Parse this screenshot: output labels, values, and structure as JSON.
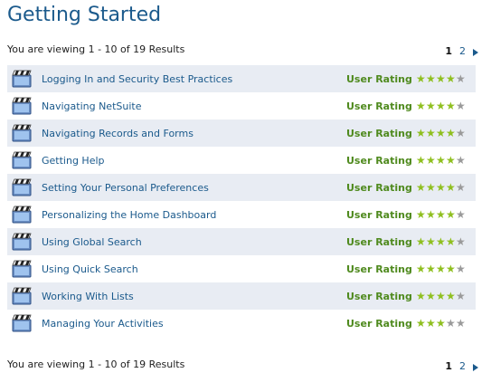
{
  "page": {
    "title": "Getting Started"
  },
  "results_summary": "You are viewing 1 - 10 of 19 Results",
  "pagination": {
    "current": "1",
    "next_page": "2"
  },
  "rating_label": "User Rating",
  "colors": {
    "title": "#1b5a8c",
    "link": "#1b5a8c",
    "rating_label": "#4f8a1e",
    "star_on": "#8fbf1f",
    "star_off": "#9a9a9a",
    "row_alt": "#e8ecf3"
  },
  "items": [
    {
      "title": "Logging In and Security Best Practices",
      "rating": 4,
      "icon": "video-clapper-icon"
    },
    {
      "title": "Navigating NetSuite",
      "rating": 4,
      "icon": "video-clapper-icon"
    },
    {
      "title": "Navigating Records and Forms",
      "rating": 4,
      "icon": "video-clapper-icon"
    },
    {
      "title": "Getting Help",
      "rating": 4,
      "icon": "video-clapper-icon"
    },
    {
      "title": "Setting Your Personal Preferences",
      "rating": 4,
      "icon": "video-clapper-icon"
    },
    {
      "title": "Personalizing the Home Dashboard",
      "rating": 4,
      "icon": "video-clapper-icon"
    },
    {
      "title": "Using Global Search",
      "rating": 4,
      "icon": "video-clapper-icon"
    },
    {
      "title": "Using Quick Search",
      "rating": 4,
      "icon": "video-clapper-icon"
    },
    {
      "title": "Working With Lists",
      "rating": 4,
      "icon": "video-clapper-icon"
    },
    {
      "title": "Managing Your Activities",
      "rating": 3,
      "icon": "video-clapper-icon"
    }
  ],
  "max_rating": 5
}
